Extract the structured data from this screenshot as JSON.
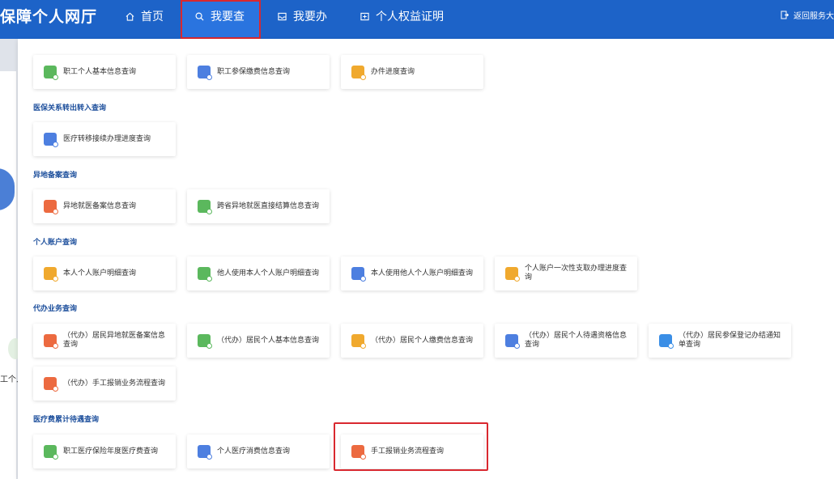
{
  "header": {
    "app_title": "保障个人网厅",
    "nav": [
      {
        "label": "首页",
        "icon": "home-icon"
      },
      {
        "label": "我要查",
        "icon": "search-icon"
      },
      {
        "label": "我要办",
        "icon": "inbox-icon"
      },
      {
        "label": "个人权益证明",
        "icon": "certificate-icon"
      }
    ],
    "back_label": "返回服务大"
  },
  "background": {
    "partial_text": "工个人"
  },
  "colors": {
    "primary": "#1d63c8",
    "highlight": "#d9282f",
    "section_title": "#1d4f9c"
  },
  "panel": {
    "top_cards": [
      {
        "label": "职工个人基本信息查询",
        "icon": "person-icon",
        "color": "#5bb85d"
      },
      {
        "label": "职工参保缴费信息查询",
        "icon": "id-card-icon",
        "color": "#4d7fe0"
      },
      {
        "label": "办件进度查询",
        "icon": "hourglass-icon",
        "color": "#f0a92e"
      }
    ],
    "sections": [
      {
        "title": "医保关系转出转入查询",
        "cards": [
          {
            "label": "医疗转移接续办理进度查询",
            "icon": "id-card-icon",
            "color": "#4d7fe0"
          }
        ]
      },
      {
        "title": "异地备案查询",
        "cards": [
          {
            "label": "异地就医备案信息查询",
            "icon": "document-icon",
            "color": "#ec6a40"
          },
          {
            "label": "跨省异地就医直接结算信息查询",
            "icon": "document-icon",
            "color": "#5bb85d"
          }
        ]
      },
      {
        "title": "个人账户查询",
        "cards": [
          {
            "label": "本人个人账户明细查询",
            "icon": "person-icon",
            "color": "#f0a92e"
          },
          {
            "label": "他人使用本人个人账户明细查询",
            "icon": "person-icon",
            "color": "#5bb85d"
          },
          {
            "label": "本人使用他人个人账户明细查询",
            "icon": "person-icon",
            "color": "#4d7fe0"
          },
          {
            "label": "个人账户一次性支取办理进度查询",
            "icon": "hand-coin-icon",
            "color": "#f0a92e"
          }
        ]
      },
      {
        "title": "代办业务查询",
        "cards": [
          {
            "label": "（代办）居民异地就医备案信息查询",
            "icon": "document-icon",
            "color": "#ec6a40"
          },
          {
            "label": "（代办）居民个人基本信息查询",
            "icon": "id-card-icon",
            "color": "#5bb85d"
          },
          {
            "label": "（代办）居民个人缴费信息查询",
            "icon": "id-card-icon",
            "color": "#f0a92e"
          },
          {
            "label": "（代办）居民个人待遇资格信息查询",
            "icon": "id-card-icon",
            "color": "#4d7fe0"
          },
          {
            "label": "（代办）居民参保登记办结通知单查询",
            "icon": "form-icon",
            "color": "#3a8ee6"
          },
          {
            "label": "（代办）手工报销业务流程查询",
            "icon": "chat-icon",
            "color": "#ec6a40"
          }
        ]
      },
      {
        "title": "医疗费累计待遇查询",
        "cards": [
          {
            "label": "职工医疗保险年度医疗费查询",
            "icon": "bottle-icon",
            "color": "#5bb85d"
          },
          {
            "label": "个人医疗消费信息查询",
            "icon": "briefcase-icon",
            "color": "#4d7fe0"
          },
          {
            "label": "手工报销业务流程查询",
            "icon": "chat-icon",
            "color": "#ec6a40"
          }
        ]
      }
    ]
  }
}
